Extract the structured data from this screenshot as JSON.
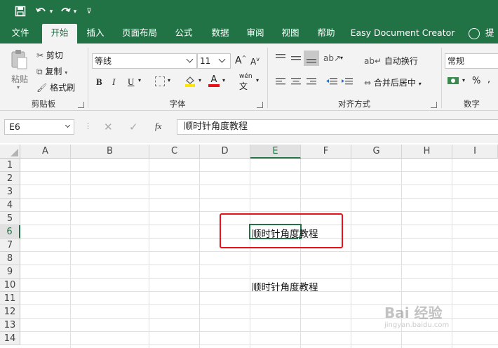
{
  "qat": {
    "save_icon": "save-icon",
    "undo_icon": "undo-icon",
    "redo_icon": "redo-icon",
    "customize_icon": "customize-icon"
  },
  "tabs": [
    {
      "label": "文件"
    },
    {
      "label": "开始"
    },
    {
      "label": "插入"
    },
    {
      "label": "页面布局"
    },
    {
      "label": "公式"
    },
    {
      "label": "数据"
    },
    {
      "label": "审阅"
    },
    {
      "label": "视图"
    },
    {
      "label": "帮助"
    },
    {
      "label": "Easy Document Creator"
    }
  ],
  "tab_cut_label": "提",
  "clipboard": {
    "paste": "粘贴",
    "cut": "剪切",
    "copy": "复制",
    "format_painter": "格式刷",
    "group_label": "剪贴板"
  },
  "font": {
    "family": "等线",
    "size": "11",
    "group_label": "字体",
    "grow": "A",
    "shrink": "A",
    "bold": "B",
    "italic": "I",
    "underline": "U",
    "font_color": "A",
    "phonetic": "wén"
  },
  "alignment": {
    "wrap": "自动换行",
    "merge": "合并后居中",
    "group_label": "对齐方式"
  },
  "number": {
    "format": "常规",
    "percent": "%",
    "group_label": "数字"
  },
  "formula_bar": {
    "name_box": "E6",
    "fx": "fx",
    "content": "顺时针角度教程"
  },
  "columns": [
    "A",
    "B",
    "C",
    "D",
    "E",
    "F",
    "G",
    "H",
    "I"
  ],
  "rows": [
    "1",
    "2",
    "3",
    "4",
    "5",
    "6",
    "7",
    "8",
    "9",
    "10",
    "11",
    "12",
    "13",
    "14"
  ],
  "cells": {
    "E6": "顺时针角度教程",
    "E10": "顺时针角度教程"
  },
  "watermark": {
    "main": "Bai 经验",
    "sub": "jingyan.baidu.com"
  },
  "colors": {
    "accent": "#217346",
    "highlight_box": "#e8101a"
  }
}
